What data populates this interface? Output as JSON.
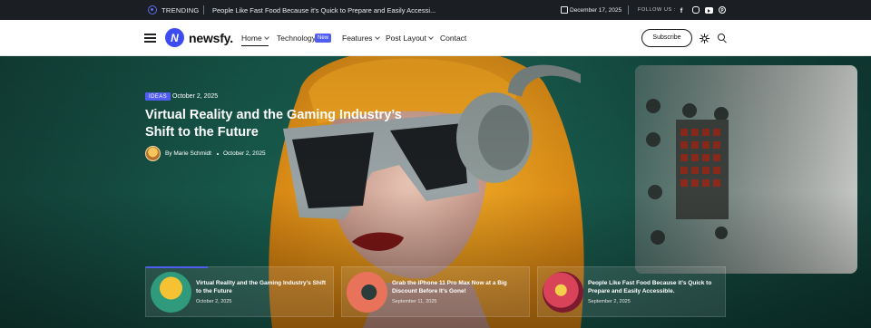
{
  "topbar": {
    "trending_label": "TRENDING",
    "ticker_text": "People Like Fast Food Because it’s Quick to Prepare and Easily Accessi...",
    "date": "December 17, 2025",
    "follow_label": "FOLLOW US :",
    "social": [
      "facebook-icon",
      "instagram-icon",
      "youtube-icon",
      "pinterest-icon"
    ]
  },
  "header": {
    "logo_mark": "N",
    "logo_text": "newsfy.",
    "nav": {
      "home": "Home",
      "technology": "Technology",
      "technology_badge": "New",
      "features": "Features",
      "post_layout": "Post Layout",
      "contact": "Contact"
    },
    "subscribe_label": "Subscribe"
  },
  "hero": {
    "category": "IDEAS",
    "date": "October 2, 2025",
    "title": "Virtual Reality and the Gaming Industry’s Shift to the Future",
    "author": "By Marie Schmidt",
    "author_date": "October 2, 2025"
  },
  "cards": [
    {
      "title": "Virtual Reality and the Gaming Industry’s Shift to the Future",
      "date": "October 2, 2025"
    },
    {
      "title": "Grab the iPhone 11 Pro Max Now at a Big Discount Before It’s Gone!",
      "date": "September 11, 2025"
    },
    {
      "title": "People Like Fast Food Because it’s Quick to Prepare and Easily Accessible.",
      "date": "September 2, 2025"
    }
  ],
  "colors": {
    "accent": "#4f5df0",
    "topbar_bg": "#1b1f23",
    "hero_green": "#17594b",
    "hair_orange": "#f2a41f"
  }
}
